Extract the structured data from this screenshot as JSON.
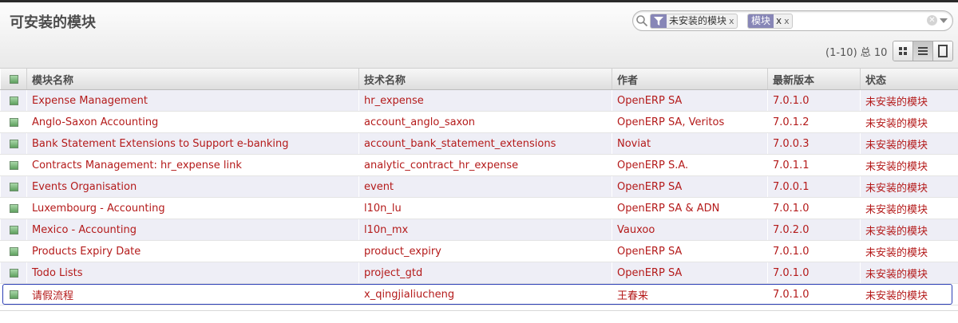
{
  "page": {
    "title": "可安装的模块"
  },
  "search": {
    "facets": [
      {
        "category_icon": "filter-icon",
        "value": "未安装的模块",
        "remove": "x"
      },
      {
        "category": "模块",
        "value": "x",
        "remove": "x"
      }
    ]
  },
  "pager": {
    "value": "(1-10) 总 10"
  },
  "view_switch": {
    "buttons": [
      {
        "icon": "kanban-view-icon",
        "active": false
      },
      {
        "icon": "list-view-icon",
        "active": true
      },
      {
        "icon": "form-view-icon",
        "active": false
      }
    ]
  },
  "table": {
    "columns": [
      "模块名称",
      "技术名称",
      "作者",
      "最新版本",
      "状态"
    ],
    "rows": [
      [
        "Expense Management",
        "hr_expense",
        "OpenERP SA",
        "7.0.1.0",
        "未安装的模块"
      ],
      [
        "Anglo-Saxon Accounting",
        "account_anglo_saxon",
        "OpenERP SA, Veritos",
        "7.0.1.2",
        "未安装的模块"
      ],
      [
        "Bank Statement Extensions to Support e-banking",
        "account_bank_statement_extensions",
        "Noviat",
        "7.0.0.3",
        "未安装的模块"
      ],
      [
        "Contracts Management: hr_expense link",
        "analytic_contract_hr_expense",
        "OpenERP S.A.",
        "7.0.1.1",
        "未安装的模块"
      ],
      [
        "Events Organisation",
        "event",
        "OpenERP SA",
        "7.0.0.1",
        "未安装的模块"
      ],
      [
        "Luxembourg - Accounting",
        "l10n_lu",
        "OpenERP SA & ADN",
        "7.0.1.0",
        "未安装的模块"
      ],
      [
        "Mexico - Accounting",
        "l10n_mx",
        "Vauxoo",
        "7.0.2.0",
        "未安装的模块"
      ],
      [
        "Products Expiry Date",
        "product_expiry",
        "OpenERP SA",
        "7.0.1.0",
        "未安装的模块"
      ],
      [
        "Todo Lists",
        "project_gtd",
        "OpenERP SA",
        "7.0.1.0",
        "未安装的模块"
      ],
      [
        "请假流程",
        "x_qingjialiucheng",
        "王春来",
        "7.0.1.0",
        "未安装的模块"
      ]
    ]
  },
  "colors": {
    "row_text": "#b41a1a",
    "row_alt_bg": "#eeeef6",
    "facet_category_bg": "#8786b7",
    "highlight_outline": "#2c3fb6"
  }
}
